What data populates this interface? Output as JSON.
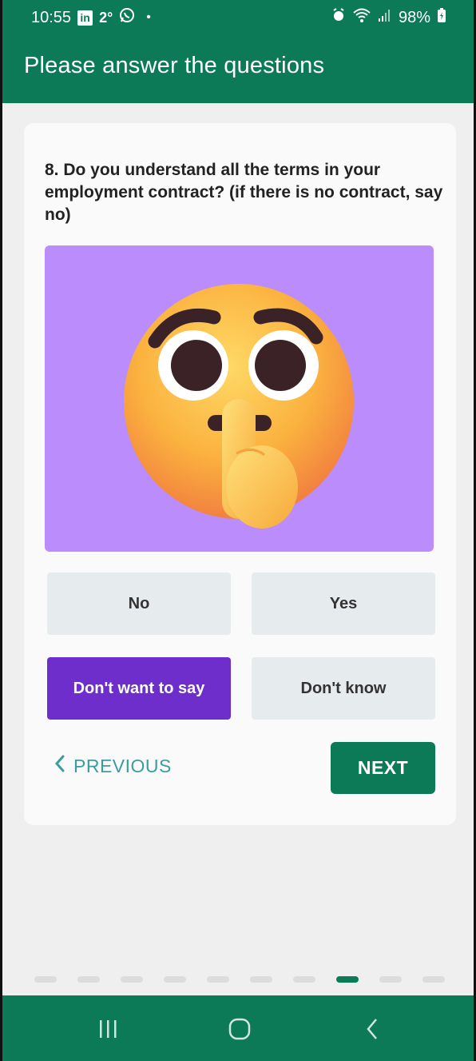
{
  "status_bar": {
    "time": "10:55",
    "linkedin_badge": "in",
    "temperature": "2°",
    "dot": "•",
    "battery": "98%",
    "icons": [
      "linkedin-icon",
      "whatsapp-icon",
      "alarm-icon",
      "wifi-icon",
      "signal-icon",
      "battery-charging-icon"
    ]
  },
  "appbar": {
    "title": "Please answer the questions"
  },
  "question": {
    "text": "8. Do you understand all the terms in your employment contract? (if there is no contract, say no)"
  },
  "illustration": {
    "icon": "shushing-face-emoji",
    "background": "#bb8cfc"
  },
  "options": [
    {
      "label": "No",
      "selected": false
    },
    {
      "label": "Yes",
      "selected": false
    },
    {
      "label": "Don't want to say",
      "selected": true
    },
    {
      "label": "Don't know",
      "selected": false
    }
  ],
  "navigation": {
    "previous_label": "PREVIOUS",
    "next_label": "NEXT"
  },
  "progress": {
    "total_steps": 10,
    "current_step": 8
  },
  "colors": {
    "primary": "#0d7a57",
    "selected": "#6e2ecc",
    "link": "#3a9ea0"
  }
}
